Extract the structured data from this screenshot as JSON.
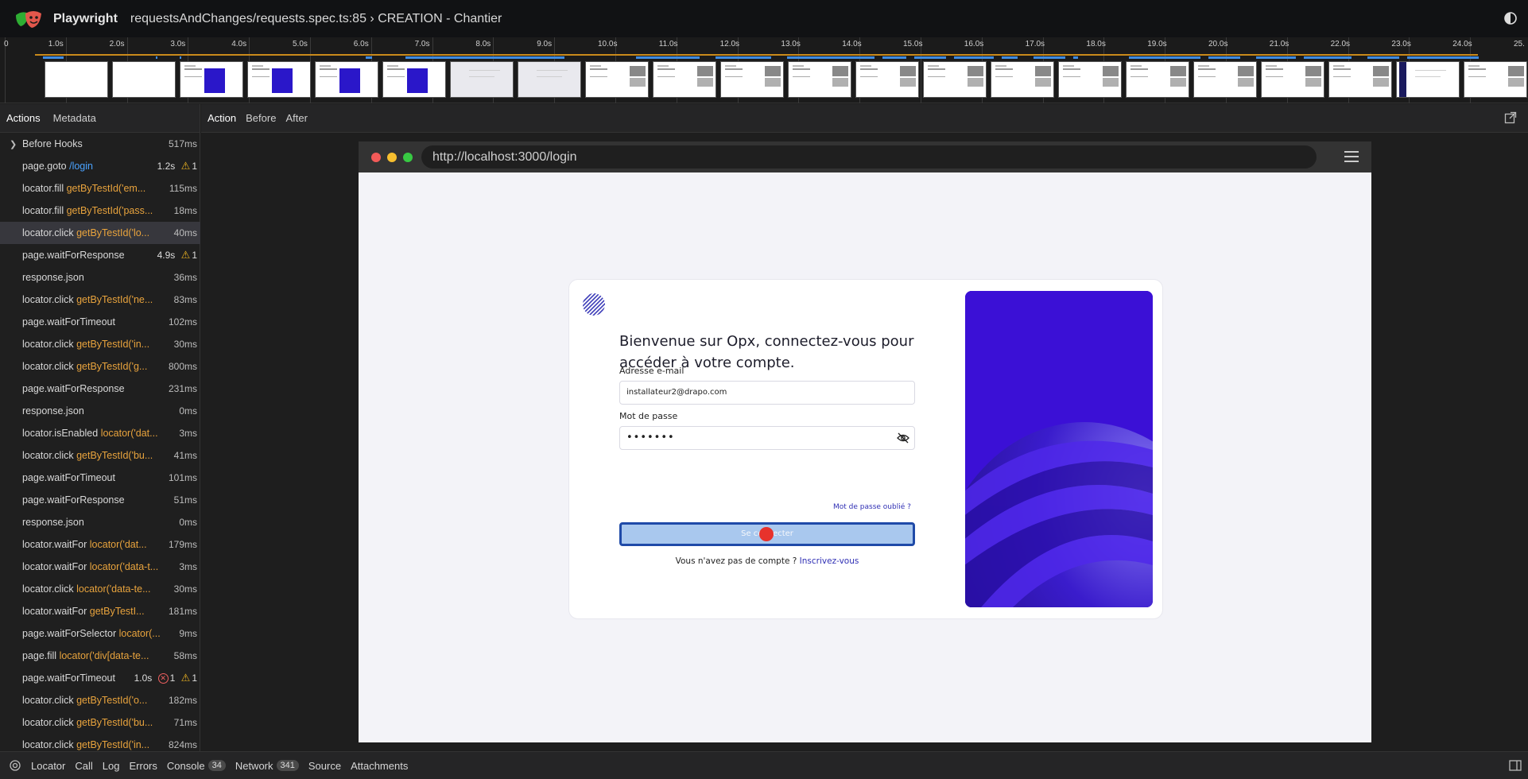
{
  "header": {
    "app_title": "Playwright",
    "test_title": "requestsAndChanges/requests.spec.ts:85 › CREATION - Chantier",
    "logo_icon": "playwright-masks-icon",
    "theme_icon": "contrast-icon"
  },
  "timeline": {
    "ticks": [
      "0",
      "1.0s",
      "2.0s",
      "3.0s",
      "4.0s",
      "5.0s",
      "6.0s",
      "7.0s",
      "8.0s",
      "9.0s",
      "10.0s",
      "11.0s",
      "12.0s",
      "13.0s",
      "14.0s",
      "15.0s",
      "16.0s",
      "17.0s",
      "18.0s",
      "19.0s",
      "20.0s",
      "21.0s",
      "22.0s",
      "23.0s",
      "24.0s",
      "25."
    ]
  },
  "left_tabs": [
    "Actions",
    "Metadata"
  ],
  "actions": [
    {
      "name": "Before Hooks",
      "selector": "",
      "duration": "517ms",
      "expandable": true
    },
    {
      "name": "page.goto",
      "selector": "/login",
      "selector_color": "blue",
      "duration": "1.2s",
      "warnings": "1"
    },
    {
      "name": "locator.fill",
      "selector": "getByTestId('em...",
      "duration": "115ms"
    },
    {
      "name": "locator.fill",
      "selector": "getByTestId('pass...",
      "duration": "18ms"
    },
    {
      "name": "locator.click",
      "selector": "getByTestId('lo...",
      "duration": "40ms",
      "selected": true
    },
    {
      "name": "page.waitForResponse",
      "selector": "",
      "duration": "4.9s",
      "warnings": "1"
    },
    {
      "name": "response.json",
      "selector": "",
      "duration": "36ms"
    },
    {
      "name": "locator.click",
      "selector": "getByTestId('ne...",
      "duration": "83ms"
    },
    {
      "name": "page.waitForTimeout",
      "selector": "",
      "duration": "102ms"
    },
    {
      "name": "locator.click",
      "selector": "getByTestId('in...",
      "duration": "30ms"
    },
    {
      "name": "locator.click",
      "selector": "getByTestId('g...",
      "duration": "800ms"
    },
    {
      "name": "page.waitForResponse",
      "selector": "",
      "duration": "231ms"
    },
    {
      "name": "response.json",
      "selector": "",
      "duration": "0ms"
    },
    {
      "name": "locator.isEnabled",
      "selector": "locator('dat...",
      "duration": "3ms"
    },
    {
      "name": "locator.click",
      "selector": "getByTestId('bu...",
      "duration": "41ms"
    },
    {
      "name": "page.waitForTimeout",
      "selector": "",
      "duration": "101ms"
    },
    {
      "name": "page.waitForResponse",
      "selector": "",
      "duration": "51ms"
    },
    {
      "name": "response.json",
      "selector": "",
      "duration": "0ms"
    },
    {
      "name": "locator.waitFor",
      "selector": "locator('dat...",
      "duration": "179ms"
    },
    {
      "name": "locator.waitFor",
      "selector": "locator('data-t...",
      "duration": "3ms"
    },
    {
      "name": "locator.click",
      "selector": "locator('data-te...",
      "duration": "30ms"
    },
    {
      "name": "locator.waitFor",
      "selector": "getByTestI...",
      "duration": "181ms"
    },
    {
      "name": "page.waitForSelector",
      "selector": "locator(...",
      "duration": "9ms"
    },
    {
      "name": "page.fill",
      "selector": "locator('div[data-te...",
      "duration": "58ms"
    },
    {
      "name": "page.waitForTimeout",
      "selector": "",
      "duration": "1.0s",
      "errors": "1",
      "warnings": "1"
    },
    {
      "name": "locator.click",
      "selector": "getByTestId('o...",
      "duration": "182ms"
    },
    {
      "name": "locator.click",
      "selector": "getByTestId('bu...",
      "duration": "71ms"
    },
    {
      "name": "locator.click",
      "selector": "getByTestId('in...",
      "duration": "824ms"
    }
  ],
  "right_tabs": [
    "Action",
    "Before",
    "After"
  ],
  "browser": {
    "url": "http://localhost:3000/login",
    "login": {
      "welcome": "Bienvenue sur Opx, connectez-vous pour accéder à votre compte.",
      "email_label": "Adresse e-mail",
      "email_value": "installateur2@drapo.com",
      "password_label": "Mot de passe",
      "password_value": "•••••••",
      "forgot": "Mot de passe oublié ?",
      "submit": "Se connecter",
      "signup_text": "Vous n'avez pas de compte ? ",
      "signup_link": "Inscrivez-vous"
    }
  },
  "bottom_tabs": [
    {
      "label": "Locator"
    },
    {
      "label": "Call"
    },
    {
      "label": "Log"
    },
    {
      "label": "Errors"
    },
    {
      "label": "Console",
      "count": "34"
    },
    {
      "label": "Network",
      "count": "341"
    },
    {
      "label": "Source"
    },
    {
      "label": "Attachments"
    }
  ],
  "colors": {
    "accent_orange": "#e8a33d",
    "accent_blue": "#4aa3ff",
    "promo_purple": "#3b10d6",
    "click_marker": "#e7322c"
  }
}
